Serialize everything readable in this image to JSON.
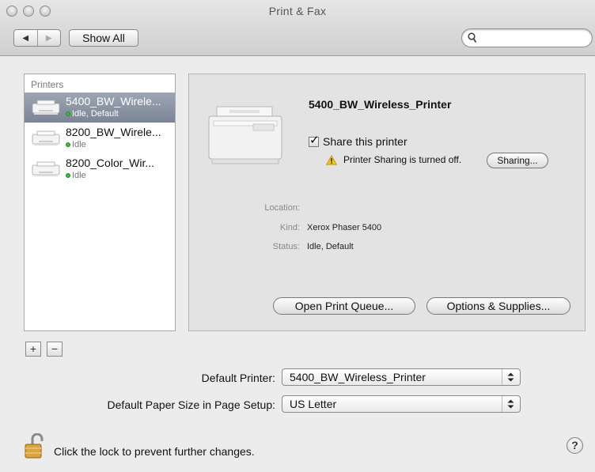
{
  "window": {
    "title": "Print & Fax"
  },
  "toolbar": {
    "show_all_label": "Show All",
    "back_icon": "◀",
    "forward_icon": "▶",
    "search_placeholder": ""
  },
  "printers": {
    "header": "Printers",
    "items": [
      {
        "name": "5400_BW_Wirele...",
        "status": "Idle, Default",
        "selected": true
      },
      {
        "name": "8200_BW_Wirele...",
        "status": "Idle",
        "selected": false
      },
      {
        "name": "8200_Color_Wir...",
        "status": "Idle",
        "selected": false
      }
    ],
    "add_label": "+",
    "remove_label": "−"
  },
  "details": {
    "printer_name": "5400_BW_Wireless_Printer",
    "share_label": "Share this printer",
    "share_checked": true,
    "sharing_warning": "Printer Sharing is turned off.",
    "sharing_button": "Sharing...",
    "location_label": "Location:",
    "location_value": "",
    "kind_label": "Kind:",
    "kind_value": "Xerox Phaser 5400",
    "status_label": "Status:",
    "status_value": "Idle, Default",
    "open_queue_button": "Open Print Queue...",
    "options_button": "Options & Supplies..."
  },
  "defaults": {
    "default_printer_label": "Default Printer:",
    "default_printer_value": "5400_BW_Wireless_Printer",
    "paper_size_label": "Default Paper Size in Page Setup:",
    "paper_size_value": "US Letter"
  },
  "footer": {
    "lock_text": "Click the lock to prevent further changes.",
    "help_label": "?"
  },
  "colors": {
    "selection": "#8890a0",
    "status_dot": "#3cb93c",
    "warning": "#f0c419"
  }
}
